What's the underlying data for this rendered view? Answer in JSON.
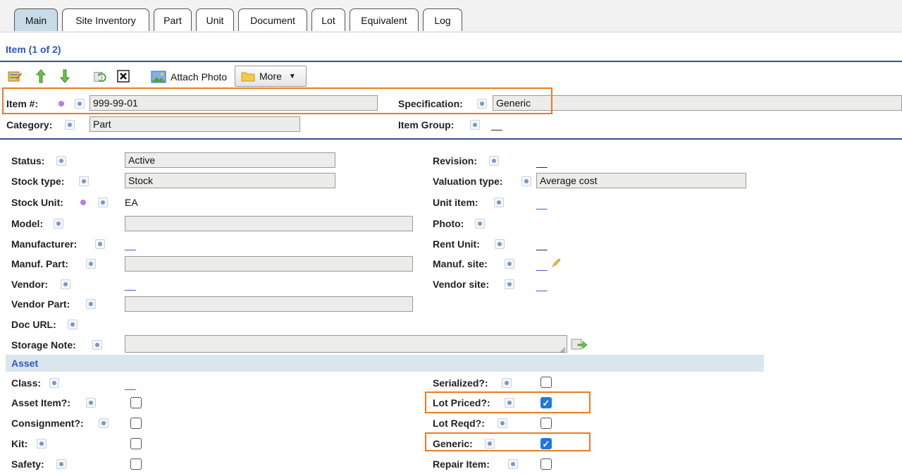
{
  "tabs": [
    "Main",
    "Site Inventory",
    "Part",
    "Unit",
    "Document",
    "Lot",
    "Equivalent",
    "Log"
  ],
  "header": {
    "title": "Item (1 of 2)"
  },
  "toolbar": {
    "attach_photo": "Attach Photo",
    "more": "More"
  },
  "top_fields": {
    "item_label": "Item #:",
    "item_value": "999-99-01",
    "spec_label": "Specification:",
    "spec_value": "Generic",
    "category_label": "Category:",
    "category_value": "Part",
    "group_label": "Item Group:",
    "group_value": "__"
  },
  "left": {
    "status_label": "Status:",
    "status_value": "Active",
    "stock_type_label": "Stock type:",
    "stock_type_value": "Stock",
    "stock_unit_label": "Stock Unit:",
    "stock_unit_value": "EA",
    "model_label": "Model:",
    "model_value": "",
    "manufacturer_label": "Manufacturer:",
    "manufacturer_value": "__",
    "manuf_part_label": "Manuf. Part:",
    "manuf_part_value": "",
    "vendor_label": "Vendor:",
    "vendor_value": "__",
    "vendor_part_label": "Vendor Part:",
    "vendor_part_value": "",
    "doc_url_label": "Doc URL:",
    "storage_note_label": "Storage Note:",
    "storage_note_value": ""
  },
  "right": {
    "revision_label": "Revision:",
    "revision_value": "__",
    "valuation_label": "Valuation type:",
    "valuation_value": "Average cost",
    "unit_item_label": "Unit item:",
    "unit_item_value": "__",
    "photo_label": "Photo:",
    "rent_unit_label": "Rent Unit:",
    "rent_unit_value": "__",
    "manuf_site_label": "Manuf. site:",
    "manuf_site_value": "__",
    "vendor_site_label": "Vendor site:",
    "vendor_site_value": "__"
  },
  "asset": {
    "section_title": "Asset",
    "class_label": "Class:",
    "class_value": "__",
    "asset_item_label": "Asset Item?:",
    "asset_item_checked": false,
    "consignment_label": "Consignment?:",
    "consignment_checked": false,
    "kit_label": "Kit:",
    "kit_checked": false,
    "safety_label": "Safety:",
    "safety_checked": false,
    "serialized_label": "Serialized?:",
    "serialized_checked": false,
    "lot_priced_label": "Lot Priced?:",
    "lot_priced_checked": true,
    "lot_reqd_label": "Lot Reqd?:",
    "lot_reqd_checked": false,
    "generic_label": "Generic:",
    "generic_checked": true,
    "repair_item_label": "Repair Item:",
    "repair_item_checked": false
  },
  "colors": {
    "accent": "#2d57c5",
    "highlight": "#ec7b22",
    "checkbox": "#1f78e0",
    "active_tab": "#c8dbe7"
  }
}
